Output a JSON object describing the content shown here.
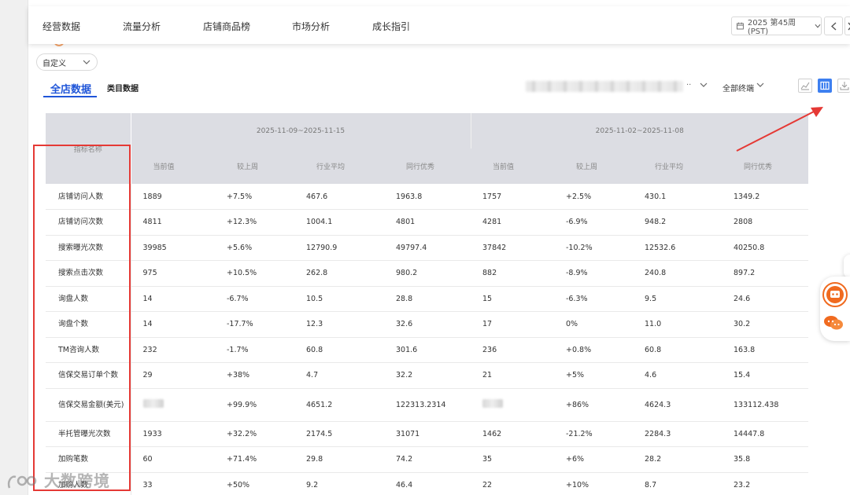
{
  "nav": {
    "tabs": [
      "经营数据",
      "流量分析",
      "店铺商品榜",
      "市场分析",
      "成长指引"
    ],
    "week": "2025 第45周 (PST)"
  },
  "filter": {
    "custom": "自定义"
  },
  "tabs": {
    "main": "全店数据",
    "category": "类目数据"
  },
  "toolbar": {
    "terminal": "全部终端",
    "ellipsis": "··"
  },
  "table": {
    "name_header": "指标名称",
    "periods": [
      "2025-11-09~2025-11-15",
      "2025-11-02~2025-11-08"
    ],
    "sub_headers": [
      "当前值",
      "较上周",
      "行业平均",
      "同行优秀"
    ],
    "rows": [
      {
        "name": "店铺访问人数",
        "p1": [
          "1889",
          "+7.5%",
          "467.6",
          "1963.8"
        ],
        "p2": [
          "1757",
          "+2.5%",
          "430.1",
          "1349.2"
        ]
      },
      {
        "name": "店铺访问次数",
        "p1": [
          "4811",
          "+12.3%",
          "1004.1",
          "4801"
        ],
        "p2": [
          "4281",
          "-6.9%",
          "948.2",
          "2808"
        ]
      },
      {
        "name": "搜索曝光次数",
        "p1": [
          "39985",
          "+5.6%",
          "12790.9",
          "49797.4"
        ],
        "p2": [
          "37842",
          "-10.2%",
          "12532.6",
          "40250.8"
        ]
      },
      {
        "name": "搜索点击次数",
        "p1": [
          "975",
          "+10.5%",
          "262.8",
          "980.2"
        ],
        "p2": [
          "882",
          "-8.9%",
          "240.8",
          "897.2"
        ]
      },
      {
        "name": "询盘人数",
        "p1": [
          "14",
          "-6.7%",
          "10.5",
          "28.8"
        ],
        "p2": [
          "15",
          "-6.3%",
          "9.5",
          "24.6"
        ]
      },
      {
        "name": "询盘个数",
        "p1": [
          "14",
          "-17.7%",
          "12.3",
          "32.6"
        ],
        "p2": [
          "17",
          "0%",
          "11.0",
          "30.2"
        ]
      },
      {
        "name": "TM咨询人数",
        "p1": [
          "232",
          "-1.7%",
          "60.8",
          "301.6"
        ],
        "p2": [
          "236",
          "+0.8%",
          "60.8",
          "163.8"
        ]
      },
      {
        "name": "信保交易订单个数",
        "p1": [
          "29",
          "+38%",
          "4.7",
          "32.2"
        ],
        "p2": [
          "21",
          "+5%",
          "4.6",
          "15.4"
        ]
      },
      {
        "name": "信保交易金额(美元)",
        "p1": [
          "",
          "+99.9%",
          "4651.2",
          "122313.2314"
        ],
        "p2": [
          "",
          "+86%",
          "4624.3",
          "133112.438"
        ]
      },
      {
        "name": "半托管曝光次数",
        "p1": [
          "1933",
          "+32.2%",
          "2174.5",
          "31071"
        ],
        "p2": [
          "1462",
          "-21.2%",
          "2284.3",
          "14447.8"
        ]
      },
      {
        "name": "加购笔数",
        "p1": [
          "60",
          "+71.4%",
          "29.8",
          "74.2"
        ],
        "p2": [
          "35",
          "+6%",
          "28.2",
          "35.8"
        ]
      },
      {
        "name": "加购人数",
        "p1": [
          "33",
          "+50%",
          "9.2",
          "46.4"
        ],
        "p2": [
          "22",
          "+10%",
          "8.7",
          "23.2"
        ]
      }
    ]
  },
  "watermark": "大数跨境",
  "colors": {
    "accent": "#1f55d8",
    "highlight": "#e53935",
    "header_bg": "#dcdde3"
  }
}
